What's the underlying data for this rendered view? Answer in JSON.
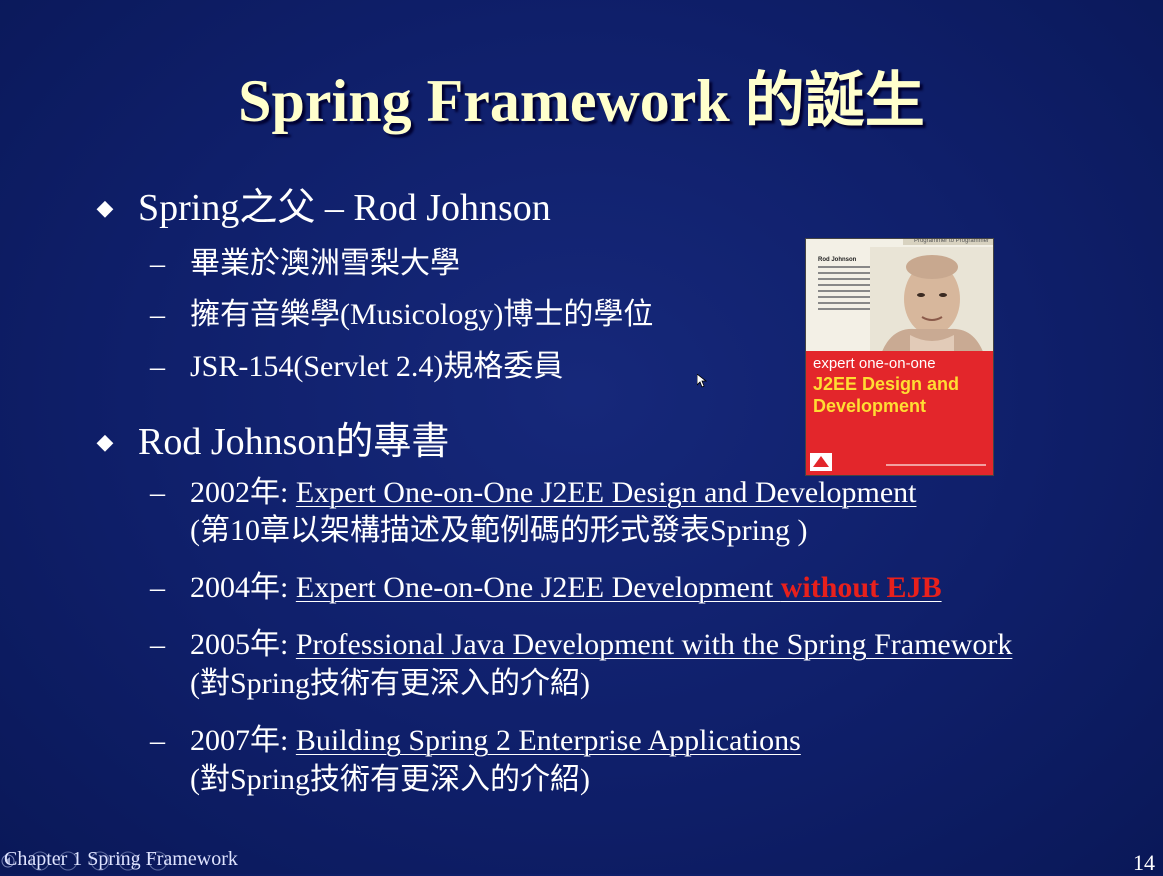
{
  "slide": {
    "title": "Spring Framework 的誕生",
    "bullets": [
      {
        "text": "Spring之父 – Rod Johnson",
        "subs": [
          "畢業於澳洲雪梨大學",
          "擁有音樂學(Musicology)博士的學位",
          "JSR-154(Servlet 2.4)規格委員"
        ]
      },
      {
        "text": "Rod Johnson的專書",
        "books": [
          {
            "year": "2002年:",
            "title": "Expert One-on-One J2EE Design and Development",
            "note": "(第10章以架構描述及範例碼的形式發表Spring )"
          },
          {
            "year": "2004年:",
            "title": "Expert One-on-One J2EE Development ",
            "highlight": "without EJB"
          },
          {
            "year": "2005年:",
            "title": "Professional Java Development with the Spring Framework",
            "note": "(對Spring技術有更深入的介紹)"
          },
          {
            "year": "2007年:",
            "title": "Building Spring 2 Enterprise Applications",
            "note": "(對Spring技術有更深入的介紹)"
          }
        ]
      }
    ],
    "dash": "–",
    "bullet_icon": "diamond-bullet-icon"
  },
  "book_cover": {
    "top_label": "Programmer to Programmer",
    "author": "Rod Johnson",
    "series": "expert one-on-one",
    "title_line1": "J2EE Design and",
    "title_line2": "Development"
  },
  "footer": {
    "chapter": "Chapter 1 Spring Framework",
    "page_number": "14"
  },
  "colors": {
    "background": "#0f1f6a",
    "title": "#ffffcc",
    "highlight": "#e8201c"
  }
}
